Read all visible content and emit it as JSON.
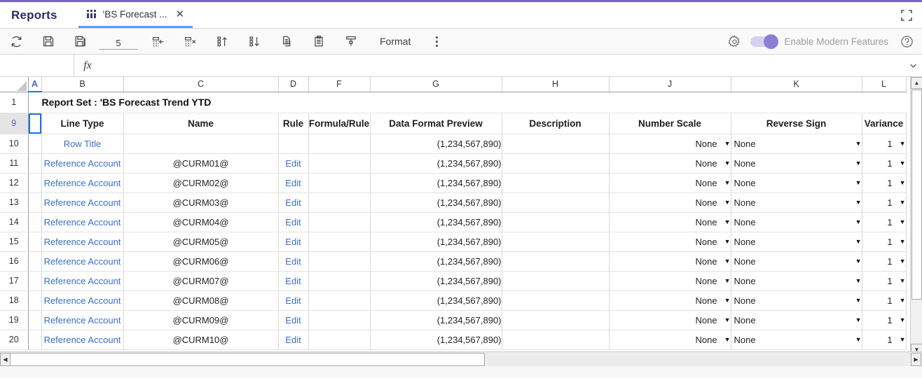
{
  "window": {
    "app_title": "Reports",
    "accent_color": "#7b61c9",
    "expand_icon": "fullscreen-icon"
  },
  "tab": {
    "icon": "grid-columns-icon",
    "label": "'BS Forecast ...",
    "close_label": "✕"
  },
  "toolbar": {
    "refresh_label": "refresh-icon",
    "save_label": "save-icon",
    "save_as_label": "save-as-icon",
    "row_count_value": "5",
    "row_count_placeholder": "",
    "insert_row_label": "insert-row-icon",
    "delete_row_label": "delete-row-icon",
    "sort_asc_label": "sort-ascending-icon",
    "sort_desc_label": "sort-descending-icon",
    "copy_label": "copy-icon",
    "paste_label": "paste-icon",
    "format_painter_label": "format-painter-icon",
    "format_button": "Format",
    "more_label": "more-options-icon",
    "settings_label": "gear-icon",
    "toggle_label": "Enable Modern Features",
    "toggle_state": "on",
    "toggle_color": "#8a7fd4",
    "help_label": "?"
  },
  "formula_bar": {
    "namebox_value": "",
    "namebox_placeholder": "",
    "fx_label": "fx",
    "formula_value": "",
    "formula_placeholder": "",
    "expand_caret": "⌄"
  },
  "grid": {
    "columns": [
      {
        "id": "A",
        "label": "A",
        "selected": true
      },
      {
        "id": "B",
        "label": "B",
        "selected": false
      },
      {
        "id": "C",
        "label": "C",
        "selected": false
      },
      {
        "id": "D",
        "label": "D",
        "selected": false
      },
      {
        "id": "F",
        "label": "F",
        "selected": false
      },
      {
        "id": "G",
        "label": "G",
        "selected": false
      },
      {
        "id": "H",
        "label": "H",
        "selected": false
      },
      {
        "id": "J",
        "label": "J",
        "selected": false
      },
      {
        "id": "K",
        "label": "K",
        "selected": false
      },
      {
        "id": "L",
        "label": "L",
        "selected": false
      }
    ],
    "title_row": {
      "row_number": "1",
      "text": "Report Set : 'BS Forecast Trend YTD"
    },
    "header_row": {
      "row_number": "9",
      "selected": true,
      "labels": {
        "line_type": "Line Type",
        "name": "Name",
        "rule": "Rule",
        "formula_rule": "Formula/Rule",
        "data_format_preview": "Data Format Preview",
        "description": "Description",
        "number_scale": "Number Scale",
        "reverse_sign": "Reverse Sign",
        "variance": "Variance"
      }
    },
    "rows": [
      {
        "row_number": "10",
        "line_type": "Row Title",
        "name": "",
        "rule": "",
        "formula_rule": "",
        "data_format_preview": "(1,234,567,890)",
        "description": "",
        "number_scale": "None",
        "reverse_sign": "None",
        "variance": "1"
      },
      {
        "row_number": "11",
        "line_type": "Reference Account",
        "name": "@CURM01@",
        "rule": "Edit",
        "formula_rule": "",
        "data_format_preview": "(1,234,567,890)",
        "description": "",
        "number_scale": "None",
        "reverse_sign": "None",
        "variance": "1"
      },
      {
        "row_number": "12",
        "line_type": "Reference Account",
        "name": "@CURM02@",
        "rule": "Edit",
        "formula_rule": "",
        "data_format_preview": "(1,234,567,890)",
        "description": "",
        "number_scale": "None",
        "reverse_sign": "None",
        "variance": "1"
      },
      {
        "row_number": "13",
        "line_type": "Reference Account",
        "name": "@CURM03@",
        "rule": "Edit",
        "formula_rule": "",
        "data_format_preview": "(1,234,567,890)",
        "description": "",
        "number_scale": "None",
        "reverse_sign": "None",
        "variance": "1"
      },
      {
        "row_number": "14",
        "line_type": "Reference Account",
        "name": "@CURM04@",
        "rule": "Edit",
        "formula_rule": "",
        "data_format_preview": "(1,234,567,890)",
        "description": "",
        "number_scale": "None",
        "reverse_sign": "None",
        "variance": "1"
      },
      {
        "row_number": "15",
        "line_type": "Reference Account",
        "name": "@CURM05@",
        "rule": "Edit",
        "formula_rule": "",
        "data_format_preview": "(1,234,567,890)",
        "description": "",
        "number_scale": "None",
        "reverse_sign": "None",
        "variance": "1"
      },
      {
        "row_number": "16",
        "line_type": "Reference Account",
        "name": "@CURM06@",
        "rule": "Edit",
        "formula_rule": "",
        "data_format_preview": "(1,234,567,890)",
        "description": "",
        "number_scale": "None",
        "reverse_sign": "None",
        "variance": "1"
      },
      {
        "row_number": "17",
        "line_type": "Reference Account",
        "name": "@CURM07@",
        "rule": "Edit",
        "formula_rule": "",
        "data_format_preview": "(1,234,567,890)",
        "description": "",
        "number_scale": "None",
        "reverse_sign": "None",
        "variance": "1"
      },
      {
        "row_number": "18",
        "line_type": "Reference Account",
        "name": "@CURM08@",
        "rule": "Edit",
        "formula_rule": "",
        "data_format_preview": "(1,234,567,890)",
        "description": "",
        "number_scale": "None",
        "reverse_sign": "None",
        "variance": "1"
      },
      {
        "row_number": "19",
        "line_type": "Reference Account",
        "name": "@CURM09@",
        "rule": "Edit",
        "formula_rule": "",
        "data_format_preview": "(1,234,567,890)",
        "description": "",
        "number_scale": "None",
        "reverse_sign": "None",
        "variance": "1"
      },
      {
        "row_number": "20",
        "line_type": "Reference Account",
        "name": "@CURM10@",
        "rule": "Edit",
        "formula_rule": "",
        "data_format_preview": "(1,234,567,890)",
        "description": "",
        "number_scale": "None",
        "reverse_sign": "None",
        "variance": "1"
      }
    ],
    "dropdown_arrow": "▼",
    "selected_cell": "A9"
  },
  "scrollbars": {
    "v_up": "▲",
    "v_down": "▼",
    "h_left": "◀",
    "h_right": "▶"
  }
}
